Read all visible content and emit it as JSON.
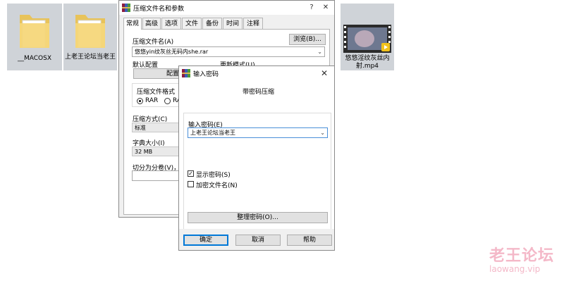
{
  "desktop": {
    "icons": [
      {
        "label": "__MACOSX",
        "type": "folder-icon"
      },
      {
        "label": "上老王论坛当老王",
        "type": "folder-icon"
      },
      {
        "label": "悠悠淫纹灰丝内射.mp4",
        "type": "video-file-icon"
      }
    ]
  },
  "archive_dialog": {
    "title": "压缩文件名和参数",
    "tabs": [
      "常规",
      "高级",
      "选项",
      "文件",
      "备份",
      "时间",
      "注释"
    ],
    "active_tab": "常规",
    "archive_name_label": "压缩文件名(A)",
    "browse_button": "浏览(B)...",
    "archive_name_value": "悠悠yin纹灰丝无码内she.rar",
    "default_profile_label": "默认配置",
    "profile_button": "配置文件",
    "update_mode_label": "更新模式(U)",
    "format_label": "压缩文件格式",
    "format_options": [
      "RAR",
      "RAR"
    ],
    "method_label": "压缩方式(C)",
    "method_value": "标准",
    "dict_label": "字典大小(I)",
    "dict_value": "32 MB",
    "split_label": "切分为分卷(V)，大"
  },
  "password_dialog": {
    "title": "输入密码",
    "heading": "带密码压缩",
    "password_label": "输入密码(E)",
    "password_value": "上老王论坛当老王",
    "show_password_label": "显示密码(S)",
    "show_password_checked": true,
    "encrypt_names_label": "加密文件名(N)",
    "encrypt_names_checked": false,
    "organize_button": "整理密码(O)...",
    "ok_button": "确定",
    "cancel_button": "取消",
    "help_button": "帮助"
  },
  "watermark": {
    "title": "老王论坛",
    "url": "laowang.vip"
  },
  "colors": {
    "accent": "#0078d7",
    "watermark": "#f4b8c8",
    "folder": "#f6d77a"
  }
}
